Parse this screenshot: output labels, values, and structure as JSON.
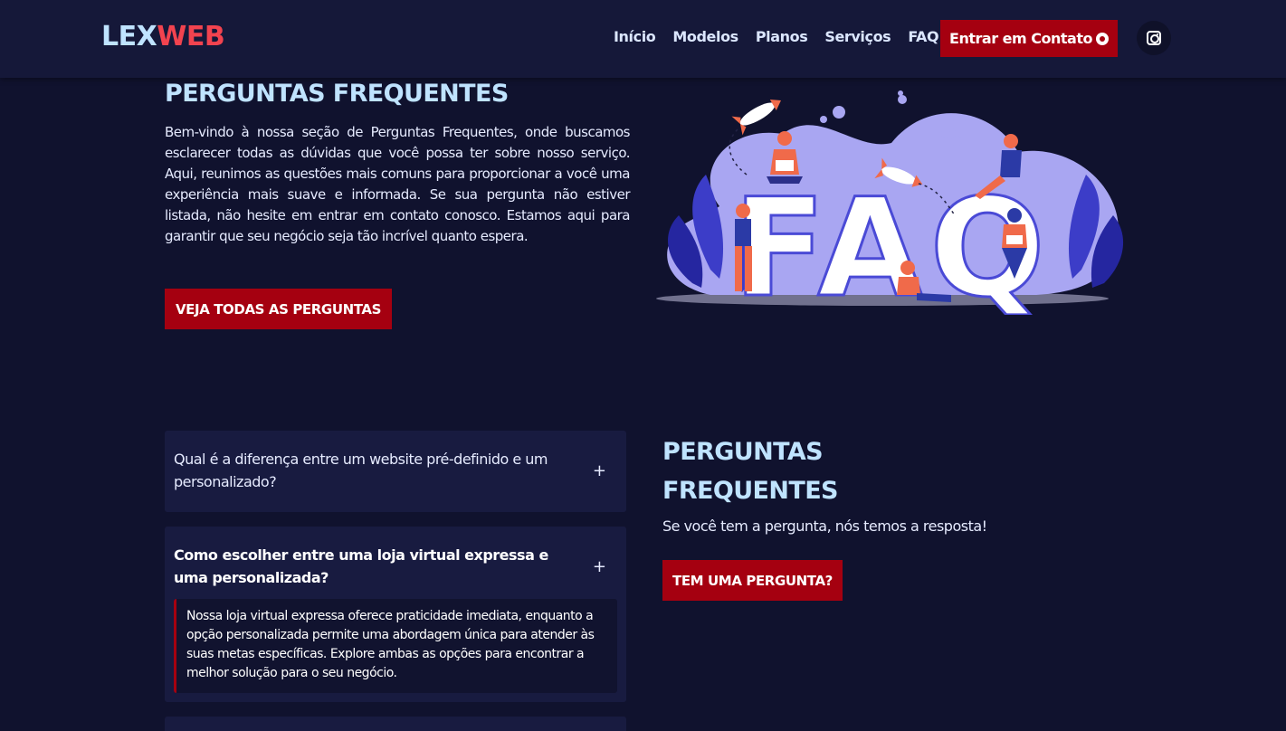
{
  "brand": {
    "part1": "LEX",
    "part2": "WEB"
  },
  "nav": {
    "links": [
      "Início",
      "Modelos",
      "Planos",
      "Serviços",
      "FAQ"
    ],
    "cta_label": "Entrar em Contato"
  },
  "hero": {
    "title": "PERGUNTAS FREQUENTES",
    "text": "Bem-vindo à nossa seção de Perguntas Frequentes, onde buscamos esclarecer todas as dúvidas que você possa ter sobre nosso serviço. Aqui, reunimos as questões mais comuns para proporcionar a você uma experiência mais suave e informada. Se sua pergunta não estiver listada, não hesite em entrar em contato conosco. Estamos aqui para garantir que seu negócio seja tão incrível quanto espera.",
    "button_label": "VEJA TODAS AS PERGUNTAS",
    "illustration_text": "FAQ"
  },
  "faq": {
    "items": [
      {
        "question": "Qual é a diferença entre um website pré-definido e um personalizado?",
        "icon": "+"
      },
      {
        "question": "Como escolher entre uma loja virtual expressa e uma personalizada?",
        "icon": "+",
        "answer": "Nossa loja virtual expressa oferece praticidade imediata, enquanto a opção personalizada permite uma abordagem única para atender às suas metas específicas. Explore ambas as opções para encontrar a melhor solução para o seu negócio."
      }
    ]
  },
  "side": {
    "title": "PERGUNTAS FREQUENTES",
    "subtitle": "Se você tem a pergunta, nós temos a resposta!",
    "button_label": "TEM UMA PERGUNTA?"
  },
  "colors": {
    "background": "#10122e",
    "navbar": "#151839",
    "accent_red": "#a50010",
    "heading_blue": "#bfe3ff",
    "logo_red": "#f2434f"
  }
}
